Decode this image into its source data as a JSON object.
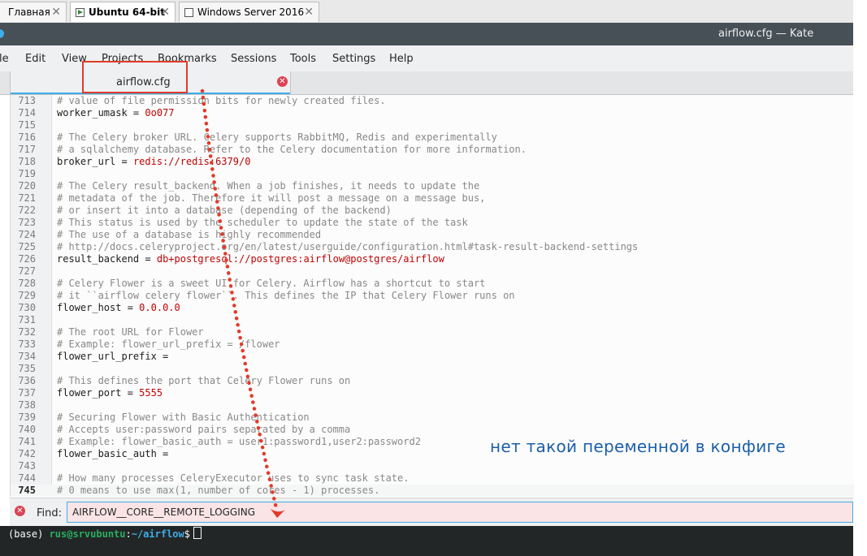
{
  "vm_tabs": [
    {
      "label": "Главная",
      "icon": "home-icon"
    },
    {
      "label": "Ubuntu 64-bit",
      "icon": "vm-running-icon",
      "active": true
    },
    {
      "label": "Windows Server 2016",
      "icon": "vm-icon"
    }
  ],
  "window": {
    "title": "airflow.cfg — Kate"
  },
  "menu": [
    "le",
    "Edit",
    "View",
    "Projects",
    "Bookmarks",
    "Sessions",
    "Tools",
    "Settings",
    "Help"
  ],
  "doc_tab": {
    "label": "airflow.cfg"
  },
  "colors": {
    "accent": "#3daee9",
    "annotation_red": "#e23a2a",
    "annotation_blue": "#1b5fa8",
    "find_error_bg": "#fbe4e6"
  },
  "code_lines": [
    {
      "num": "713",
      "tokens": [
        {
          "t": "c",
          "v": "# value of file permission bits for newly created files."
        }
      ]
    },
    {
      "num": "714",
      "tokens": [
        {
          "t": "k",
          "v": "worker_umask"
        },
        {
          "t": "o",
          "v": " = "
        },
        {
          "t": "v",
          "v": "0o077"
        }
      ]
    },
    {
      "num": "715",
      "tokens": []
    },
    {
      "num": "716",
      "tokens": [
        {
          "t": "c",
          "v": "# The Celery broker URL. Celery supports RabbitMQ, Redis and experimentally"
        }
      ]
    },
    {
      "num": "717",
      "tokens": [
        {
          "t": "c",
          "v": "# a sqlalchemy database. Refer to the Celery documentation for more information."
        }
      ]
    },
    {
      "num": "718",
      "tokens": [
        {
          "t": "k",
          "v": "broker_url"
        },
        {
          "t": "o",
          "v": " = "
        },
        {
          "t": "v",
          "v": "redis://redis:6379/0"
        }
      ]
    },
    {
      "num": "719",
      "tokens": []
    },
    {
      "num": "720",
      "tokens": [
        {
          "t": "c",
          "v": "# The Celery result_backend. When a job finishes, it needs to update the"
        }
      ]
    },
    {
      "num": "721",
      "tokens": [
        {
          "t": "c",
          "v": "# metadata of the job. Therefore it will post a message on a message bus,"
        }
      ]
    },
    {
      "num": "722",
      "tokens": [
        {
          "t": "c",
          "v": "# or insert it into a database (depending of the backend)"
        }
      ]
    },
    {
      "num": "723",
      "tokens": [
        {
          "t": "c",
          "v": "# This status is used by the scheduler to update the state of the task"
        }
      ]
    },
    {
      "num": "724",
      "tokens": [
        {
          "t": "c",
          "v": "# The use of a database is highly recommended"
        }
      ]
    },
    {
      "num": "725",
      "tokens": [
        {
          "t": "c",
          "v": "# http://docs.celeryproject.org/en/latest/userguide/configuration.html#task-result-backend-settings"
        }
      ]
    },
    {
      "num": "726",
      "tokens": [
        {
          "t": "k",
          "v": "result_backend"
        },
        {
          "t": "o",
          "v": " = "
        },
        {
          "t": "v",
          "v": "db+postgresql://postgres:airflow@postgres/airflow"
        }
      ]
    },
    {
      "num": "727",
      "tokens": []
    },
    {
      "num": "728",
      "tokens": [
        {
          "t": "c",
          "v": "# Celery Flower is a sweet UI for Celery. Airflow has a shortcut to start"
        }
      ]
    },
    {
      "num": "729",
      "tokens": [
        {
          "t": "c",
          "v": "# it ``airflow celery flower``. This defines the IP that Celery Flower runs on"
        }
      ]
    },
    {
      "num": "730",
      "tokens": [
        {
          "t": "k",
          "v": "flower_host"
        },
        {
          "t": "o",
          "v": " = "
        },
        {
          "t": "v",
          "v": "0.0.0.0"
        }
      ]
    },
    {
      "num": "731",
      "tokens": []
    },
    {
      "num": "732",
      "tokens": [
        {
          "t": "c",
          "v": "# The root URL for Flower"
        }
      ]
    },
    {
      "num": "733",
      "tokens": [
        {
          "t": "c",
          "v": "# Example: flower_url_prefix = /flower"
        }
      ]
    },
    {
      "num": "734",
      "tokens": [
        {
          "t": "k",
          "v": "flower_url_prefix"
        },
        {
          "t": "o",
          "v": " ="
        }
      ]
    },
    {
      "num": "735",
      "tokens": []
    },
    {
      "num": "736",
      "tokens": [
        {
          "t": "c",
          "v": "# This defines the port that Celery Flower runs on"
        }
      ]
    },
    {
      "num": "737",
      "tokens": [
        {
          "t": "k",
          "v": "flower_port"
        },
        {
          "t": "o",
          "v": " = "
        },
        {
          "t": "v",
          "v": "5555"
        }
      ]
    },
    {
      "num": "738",
      "tokens": []
    },
    {
      "num": "739",
      "tokens": [
        {
          "t": "c",
          "v": "# Securing Flower with Basic Authentication"
        }
      ]
    },
    {
      "num": "740",
      "tokens": [
        {
          "t": "c",
          "v": "# Accepts user:password pairs separated by a comma"
        }
      ]
    },
    {
      "num": "741",
      "tokens": [
        {
          "t": "c",
          "v": "# Example: flower_basic_auth = user1:password1,user2:password2"
        }
      ]
    },
    {
      "num": "742",
      "tokens": [
        {
          "t": "k",
          "v": "flower_basic_auth"
        },
        {
          "t": "o",
          "v": " ="
        }
      ]
    },
    {
      "num": "743",
      "tokens": []
    },
    {
      "num": "744",
      "tokens": [
        {
          "t": "c",
          "v": "# How many processes CeleryExecutor uses to sync task state."
        }
      ]
    },
    {
      "num": "745",
      "tokens": [
        {
          "t": "c",
          "v": "# 0 means to use max(1, number of cores - 1) processes."
        }
      ],
      "current": true
    }
  ],
  "find_bar": {
    "label": "Find:",
    "query": "AIRFLOW__CORE__REMOTE_LOGGING"
  },
  "terminal": {
    "env": "(base) ",
    "user": "rus@srvubuntu",
    "sep": ":",
    "path": "~/airflow",
    "prompt": "$"
  },
  "annotation": {
    "note": "нет такой переменной в конфиге"
  }
}
